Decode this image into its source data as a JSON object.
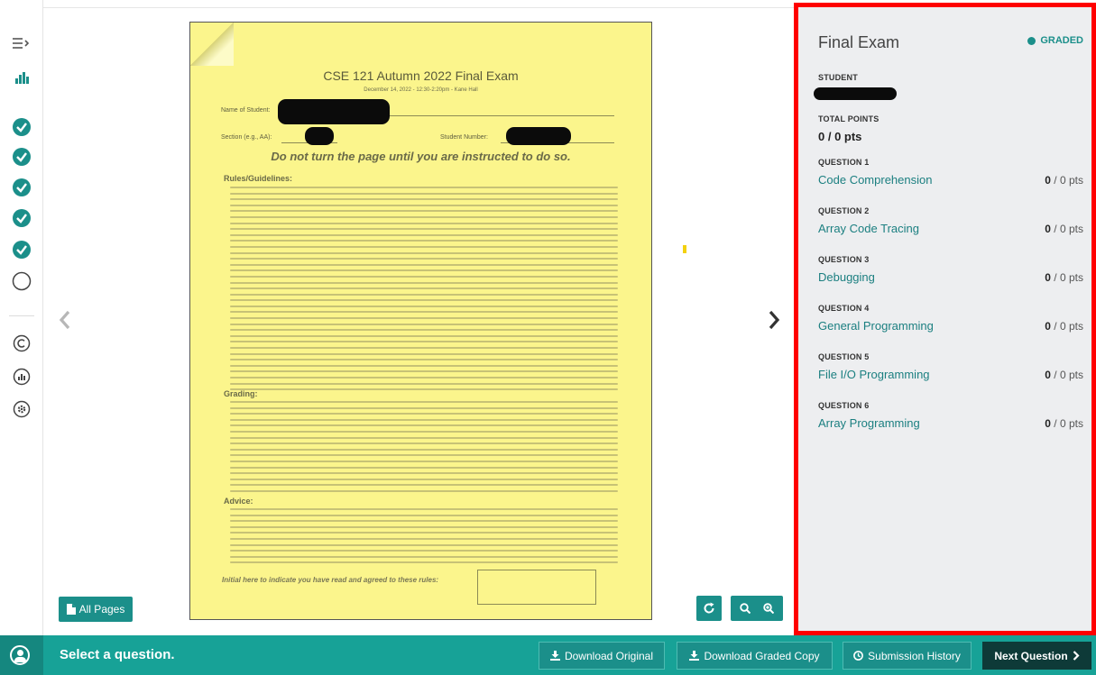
{
  "sidebar": {
    "items": [
      {
        "icon": "menu-expand-icon"
      },
      {
        "icon": "bar-chart-icon"
      },
      {
        "icon": "check-circle-icon",
        "state": "done"
      },
      {
        "icon": "check-circle-icon",
        "state": "done"
      },
      {
        "icon": "check-circle-icon",
        "state": "done"
      },
      {
        "icon": "check-circle-icon",
        "state": "done"
      },
      {
        "icon": "check-circle-icon",
        "state": "done"
      },
      {
        "icon": "empty-circle-icon",
        "state": "pending"
      },
      {
        "icon": "copyright-icon"
      },
      {
        "icon": "stats-icon"
      },
      {
        "icon": "settings-icon"
      }
    ]
  },
  "document": {
    "title": "CSE 121 Autumn 2022 Final Exam",
    "subtitle": "December 14, 2022 - 12:30-2:20pm - Kane Hall",
    "name_label": "Name of Student:",
    "section_label": "Section (e.g., AA):",
    "student_number_label": "Student Number:",
    "warning": "Do not turn the page until you are instructed to do so.",
    "headings": [
      "Rules/Guidelines:",
      "Grading:",
      "Advice:"
    ],
    "initial_prompt": "Initial here to indicate you have read and agreed to these rules:"
  },
  "viewer": {
    "all_pages_label": "All Pages",
    "prev_icon": "chevron-left-icon",
    "next_icon": "chevron-right-icon"
  },
  "panel": {
    "title": "Final Exam",
    "status": "GRADED",
    "student_label": "STUDENT",
    "total_label": "TOTAL POINTS",
    "total_value": "0 / 0 pts",
    "questions": [
      {
        "label": "QUESTION 1",
        "name": "Code Comprehension",
        "score": "0",
        "max": " / 0 pts"
      },
      {
        "label": "QUESTION 2",
        "name": "Array Code Tracing",
        "score": "0",
        "max": " / 0 pts"
      },
      {
        "label": "QUESTION 3",
        "name": "Debugging",
        "score": "0",
        "max": " / 0 pts"
      },
      {
        "label": "QUESTION 4",
        "name": "General Programming",
        "score": "0",
        "max": " / 0 pts"
      },
      {
        "label": "QUESTION 5",
        "name": "File I/O Programming",
        "score": "0",
        "max": " / 0 pts"
      },
      {
        "label": "QUESTION 6",
        "name": "Array Programming",
        "score": "0",
        "max": " / 0 pts"
      }
    ]
  },
  "bottom_bar": {
    "prompt": "Select a question.",
    "download_original": "Download Original",
    "download_graded": "Download Graded Copy",
    "submission_history": "Submission History",
    "next_question": "Next Question"
  },
  "colors": {
    "accent": "#1b8f8a",
    "bottom_bar": "#17a297",
    "highlight_border": "#ff0000",
    "page_yellow": "#fbf58c"
  }
}
